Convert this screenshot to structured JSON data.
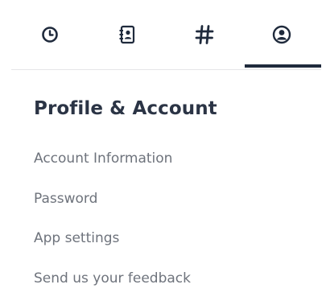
{
  "tabs": [
    {
      "icon": "clock-icon",
      "active": false
    },
    {
      "icon": "contacts-book-icon",
      "active": false
    },
    {
      "icon": "hashtag-icon",
      "active": false
    },
    {
      "icon": "user-profile-icon",
      "active": true
    }
  ],
  "section": {
    "title": "Profile & Account"
  },
  "menu": {
    "items": [
      {
        "label": "Account Information"
      },
      {
        "label": "Password"
      },
      {
        "label": "App settings"
      },
      {
        "label": "Send us your feedback"
      }
    ]
  },
  "colors": {
    "icon": "#1f2a3c",
    "active_indicator": "#1f2a3c",
    "title": "#2b3445",
    "menu_text": "#6e737c",
    "divider": "#e6e6e8"
  }
}
